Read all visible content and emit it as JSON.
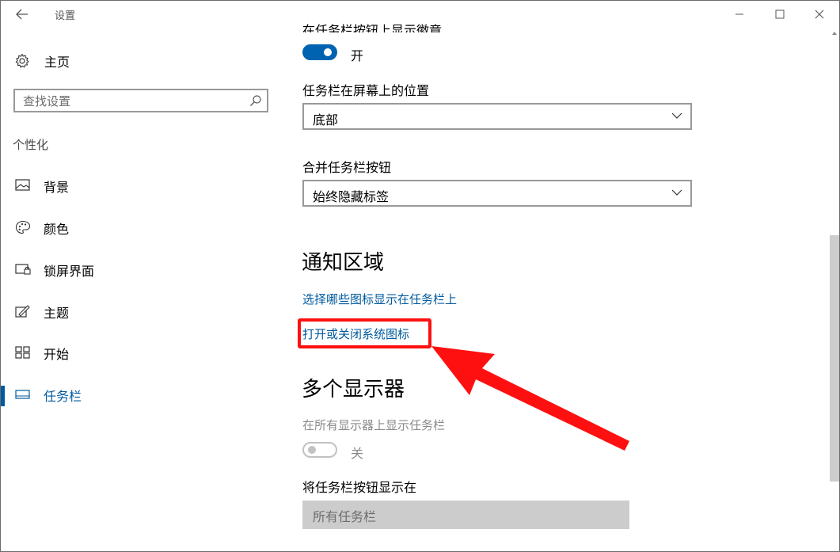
{
  "window": {
    "title": "设置"
  },
  "sidebar": {
    "home_label": "主页",
    "search_placeholder": "查找设置",
    "section_label": "个性化",
    "items": [
      {
        "label": "背景",
        "icon": "image-icon"
      },
      {
        "label": "颜色",
        "icon": "palette-icon"
      },
      {
        "label": "锁屏界面",
        "icon": "lock-screen-icon"
      },
      {
        "label": "主题",
        "icon": "theme-brush-icon"
      },
      {
        "label": "开始",
        "icon": "start-grid-icon"
      },
      {
        "label": "任务栏",
        "icon": "taskbar-icon",
        "active": true
      }
    ]
  },
  "content": {
    "cut_top_label": "在任务栏按钮上显示徽章",
    "badge_toggle": {
      "state": "on",
      "text": "开"
    },
    "position_label": "任务栏在屏幕上的位置",
    "position_value": "底部",
    "combine_label": "合并任务栏按钮",
    "combine_value": "始终隐藏标签",
    "notification_heading": "通知区域",
    "link_select_icons": "选择哪些图标显示在任务栏上",
    "link_system_icons": "打开或关闭系统图标",
    "multi_display_heading": "多个显示器",
    "show_all_displays_label": "在所有显示器上显示任务栏",
    "show_all_displays_toggle": {
      "state": "off",
      "text": "关"
    },
    "show_buttons_on_label": "将任务栏按钮显示在",
    "show_buttons_on_value": "所有任务栏"
  },
  "colors": {
    "accent": "#0063b1",
    "link": "#005a9e",
    "annotation": "#ff1010"
  }
}
